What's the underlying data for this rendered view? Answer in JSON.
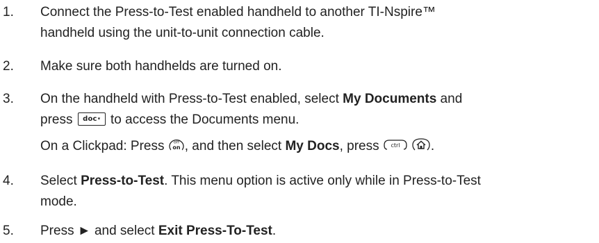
{
  "steps": [
    {
      "number": "1.",
      "line1": "Connect the Press-to-Test enabled handheld to another TI-Nspire™",
      "line2": "handheld using the unit-to-unit connection cable."
    },
    {
      "number": "2.",
      "line1": "Make sure both handhelds are turned on."
    },
    {
      "number": "3.",
      "line1_pre": "On the handheld with Press-to-Test enabled, select ",
      "line1_bold": "My Documents",
      "line1_post": " and",
      "line2_pre": "press ",
      "line2_post": " to access the Documents menu.",
      "clickpad_pre": "On a Clickpad: Press ",
      "clickpad_mid1": ", and then select ",
      "clickpad_bold": "My Docs",
      "clickpad_mid2": ", press ",
      "clickpad_end": "."
    },
    {
      "number": "4.",
      "line1_pre": "Select ",
      "line1_bold": "Press-to-Test",
      "line1_post": ". This menu option is active only while in Press-to-Test",
      "line2": "mode."
    },
    {
      "number": "5.",
      "line1_pre": "Press ",
      "arrow": "►",
      "line1_mid": " and select ",
      "line1_bold": "Exit Press-To-Test",
      "line1_post": "."
    }
  ],
  "keys": {
    "doc": "doc",
    "doc_arrow": "▾",
    "off": "off",
    "on": "on",
    "ctrl": "ctrl"
  },
  "icons": {
    "doc_key": "doc-key-icon",
    "on_key": "on-off-key-icon",
    "ctrl_key": "ctrl-key-icon",
    "home_key": "home-key-icon"
  }
}
